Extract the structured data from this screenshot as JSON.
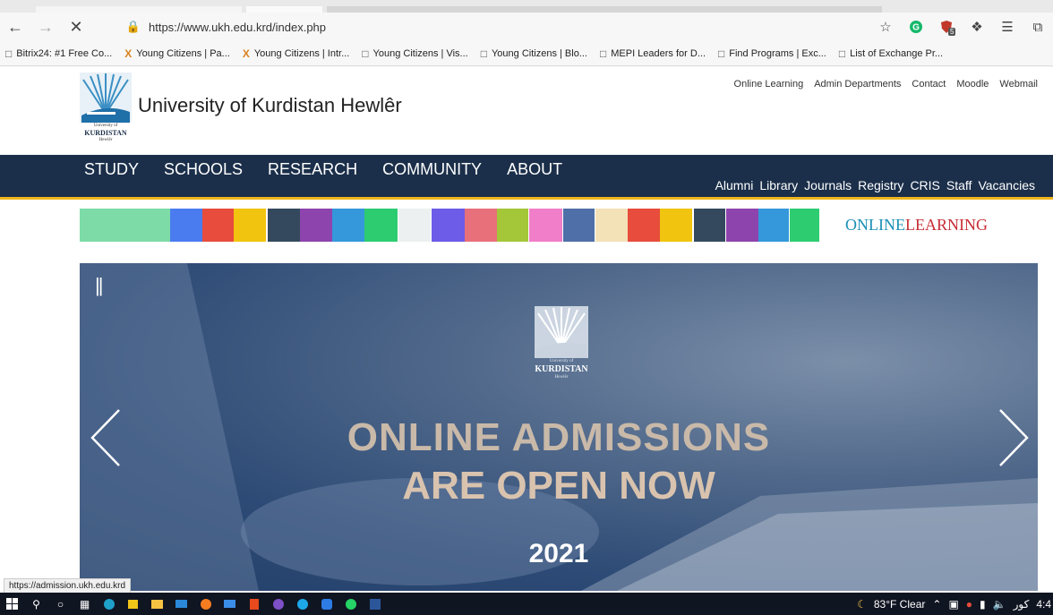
{
  "browser": {
    "url": "https://www.ukh.edu.krd/index.php",
    "bookmarks": [
      {
        "label": "Bitrix24: #1 Free Co...",
        "icon": "page-icon"
      },
      {
        "label": "Young Citizens | Pa...",
        "icon": "x-logo-icon"
      },
      {
        "label": "Young Citizens | Intr...",
        "icon": "x-logo-icon"
      },
      {
        "label": "Young Citizens | Vis...",
        "icon": "page-icon"
      },
      {
        "label": "Young Citizens | Blo...",
        "icon": "page-icon"
      },
      {
        "label": "MEPI Leaders for D...",
        "icon": "page-icon"
      },
      {
        "label": "Find Programs | Exc...",
        "icon": "page-icon"
      },
      {
        "label": "List of Exchange Pr...",
        "icon": "page-icon"
      }
    ],
    "extension_badge": "5",
    "status_url": "https://admission.ukh.edu.krd"
  },
  "site": {
    "name": "University of Kurdistan Hewlêr",
    "logo_text": {
      "top": "University of",
      "main": "KURDISTAN",
      "bottom": "Hewlêr"
    },
    "util_links": [
      "Online Learning",
      "Admin Departments",
      "Contact",
      "Moodle",
      "Webmail"
    ],
    "primary_nav": [
      "STUDY",
      "SCHOOLS",
      "RESEARCH",
      "COMMUNITY",
      "ABOUT"
    ],
    "secondary_nav": [
      "Alumni",
      "Library",
      "Journals",
      "Registry",
      "CRIS",
      "Staff",
      "Vacancies"
    ],
    "online_learning": {
      "part1": "ONLINE",
      "part2": "LEARNING"
    },
    "colors": {
      "nav_bg": "#1b2f4a",
      "nav_accent": "#f0b51c"
    }
  },
  "hero": {
    "pause": "||",
    "line1": "ONLINE ADMISSIONS",
    "line2": "ARE OPEN NOW",
    "year": "2021"
  },
  "taskbar": {
    "weather": "83°F Clear",
    "lang": "کور",
    "time": "4:4"
  }
}
